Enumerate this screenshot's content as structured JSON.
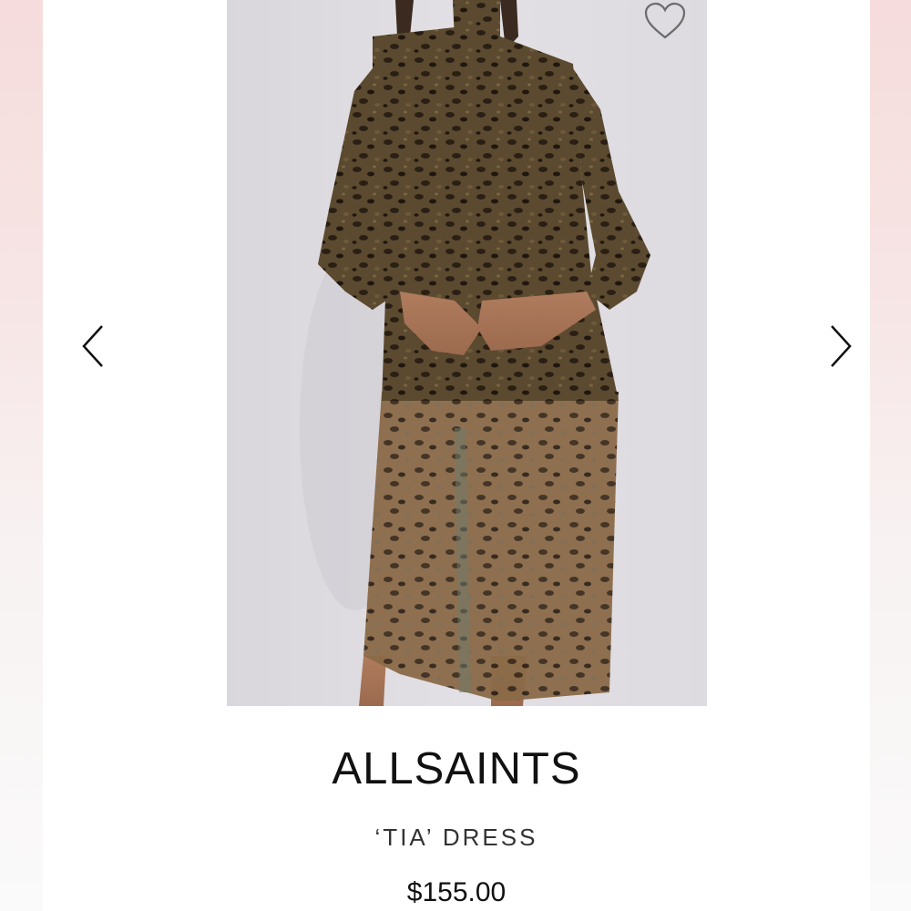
{
  "product": {
    "brand": "ALLSAINTS",
    "name": "‘TIA’ DRESS",
    "price": "$155.00"
  },
  "gallery": {
    "image_description": "Model wearing leopard print sheer mesh midi dress with long sleeves",
    "prev_icon": "chevron-left-icon",
    "next_icon": "chevron-right-icon",
    "wishlist_icon": "heart-outline-icon"
  },
  "colors": {
    "text": "#111111",
    "subtext": "#333333",
    "dress": "#4a3a24"
  }
}
